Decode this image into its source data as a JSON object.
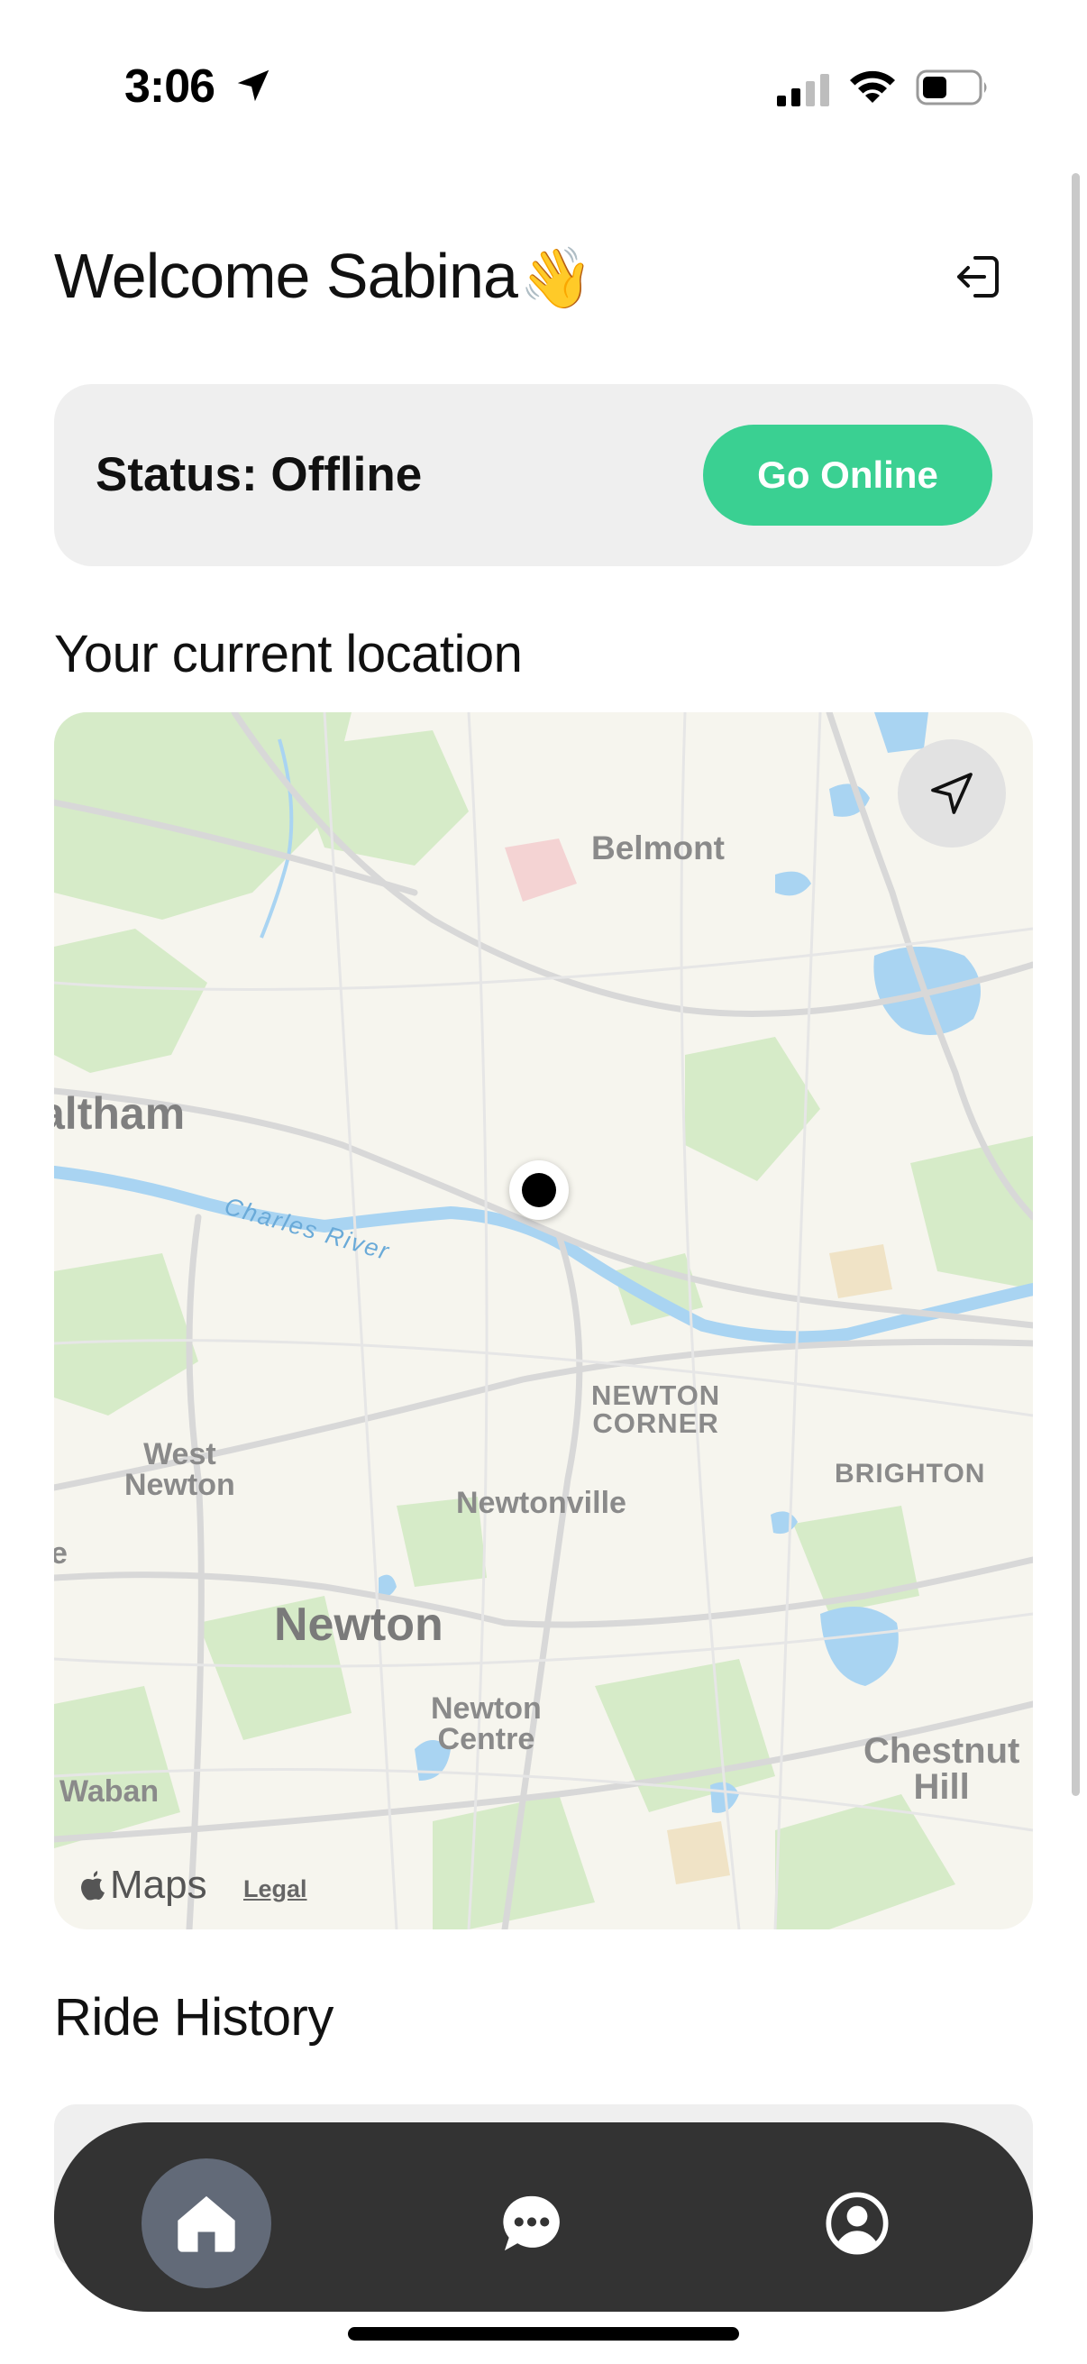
{
  "status_bar": {
    "time": "3:06"
  },
  "header": {
    "welcome": "Welcome Sabina",
    "wave_emoji": "👋",
    "logout_icon": "logout-icon"
  },
  "status_card": {
    "status_text": "Status: Offline",
    "go_online_label": "Go Online"
  },
  "location_section": {
    "title": "Your current location"
  },
  "map": {
    "labels": {
      "belmont": "Belmont",
      "waltham": "altham",
      "charles_river": "Charles River",
      "newton_corner_1": "NEWTON",
      "newton_corner_2": "CORNER",
      "brighton": "BRIGHTON",
      "west_newton_1": "West",
      "west_newton_2": "Newton",
      "newtonville": "Newtonville",
      "edge_e": "e",
      "newton": "Newton",
      "newton_centre_1": "Newton",
      "newton_centre_2": "Centre",
      "chestnut_1": "Chestnut",
      "chestnut_2": "Hill",
      "waban": "Waban"
    },
    "attribution": "Maps",
    "legal": "Legal"
  },
  "ride_history": {
    "title": "Ride History"
  },
  "tab_bar": {
    "tabs": [
      "home-icon",
      "chat-icon",
      "profile-icon"
    ],
    "active": "home-icon"
  },
  "colors": {
    "accent": "#3ad092",
    "tab_bar": "#333333",
    "active_tab": "#626a78",
    "card": "#efefef"
  }
}
